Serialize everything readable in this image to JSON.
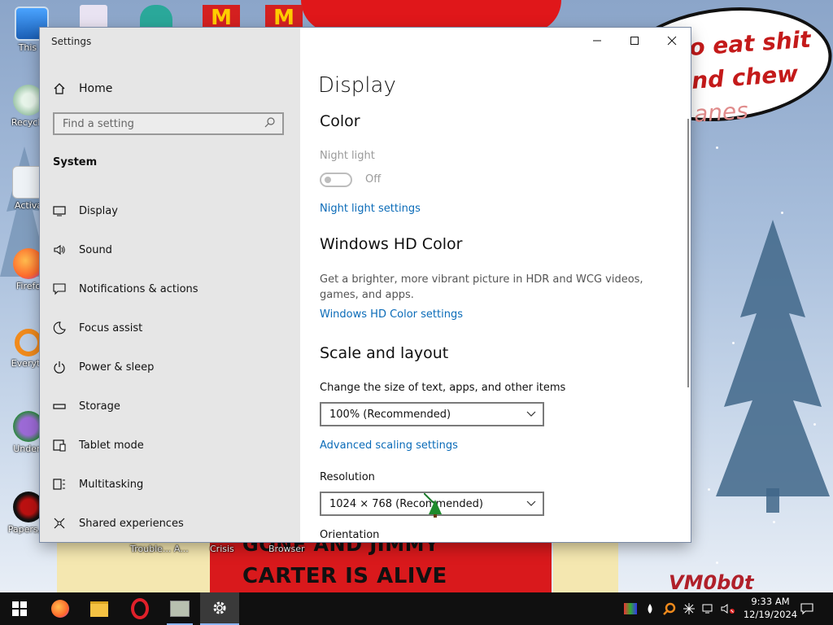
{
  "desktop": {
    "bubble_lines": [
      "o eat shit",
      "nd chew",
      "anes"
    ],
    "banner_top": "GONE AND JIMMY",
    "banner_bottom": "CARTER IS ALIVE",
    "signature": "VM0b0t",
    "icons": [
      {
        "label": "This P",
        "icon": "pc-icon"
      },
      {
        "label": "Recycle",
        "icon": "recycle-bin-icon"
      },
      {
        "label": "Activa",
        "icon": "file-icon"
      },
      {
        "label": "Firefo",
        "icon": "firefox-icon"
      },
      {
        "label": "Everyth",
        "icon": "everything-search-icon"
      },
      {
        "label": "Undert",
        "icon": "undertale-icon"
      },
      {
        "label": "Papers, P",
        "icon": "papers-please-icon"
      }
    ],
    "bottom_labels": [
      "Trouble... A...",
      "Crisis",
      "Browser"
    ]
  },
  "window": {
    "title": "Settings",
    "controls": {
      "minimize": "–",
      "maximize": "☐",
      "close": "✕"
    }
  },
  "nav": {
    "home": "Home",
    "search_placeholder": "Find a setting",
    "section": "System",
    "items": [
      {
        "label": "Display",
        "icon": "monitor-icon"
      },
      {
        "label": "Sound",
        "icon": "speaker-icon"
      },
      {
        "label": "Notifications & actions",
        "icon": "notification-icon"
      },
      {
        "label": "Focus assist",
        "icon": "moon-icon"
      },
      {
        "label": "Power & sleep",
        "icon": "power-icon"
      },
      {
        "label": "Storage",
        "icon": "storage-icon"
      },
      {
        "label": "Tablet mode",
        "icon": "tablet-icon"
      },
      {
        "label": "Multitasking",
        "icon": "multitasking-icon"
      },
      {
        "label": "Shared experiences",
        "icon": "shared-icon"
      }
    ]
  },
  "content": {
    "page_title": "Display",
    "color_heading": "Color",
    "night_light_label": "Night light",
    "night_light_state": "Off",
    "night_light_link": "Night light settings",
    "hd_heading": "Windows HD Color",
    "hd_desc": "Get a brighter, more vibrant picture in HDR and WCG videos, games, and apps.",
    "hd_link": "Windows HD Color settings",
    "scale_heading": "Scale and layout",
    "scale_label": "Change the size of text, apps, and other items",
    "scale_value": "100% (Recommended)",
    "advanced_link": "Advanced scaling settings",
    "resolution_label": "Resolution",
    "resolution_value": "1024 × 768 (Recommended)",
    "orientation_label": "Orientation"
  },
  "taskbar": {
    "time": "9:33 AM",
    "date": "12/19/2024",
    "apps": [
      "start-icon",
      "firefox-icon",
      "file-explorer-icon",
      "opera-icon",
      "app-icon",
      "settings-icon"
    ]
  }
}
